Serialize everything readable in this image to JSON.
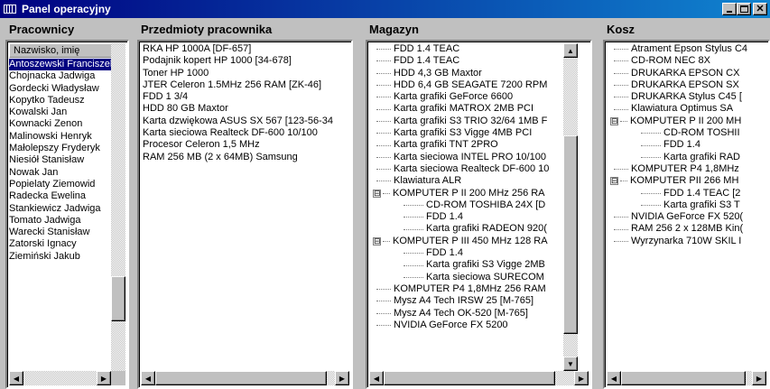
{
  "window": {
    "title": "Panel operacyjny",
    "icon": "panel-icon"
  },
  "pracownicy": {
    "header": "Pracownicy",
    "column": "Nazwisko, imię",
    "selected_index": 0,
    "items": [
      "Antoszewski Franciszek",
      "Chojnacka Jadwiga",
      "Gordecki Władysław",
      "Kopytko Tadeusz",
      "Kowalski Jan",
      "Kownacki Zenon",
      "Malinowski Henryk",
      "Małolepszy Fryderyk",
      "Niesiół Stanisław",
      "Nowak Jan",
      "Popielaty Ziemowid",
      "Radecka Ewelina",
      "Stankiewicz Jadwiga",
      "Tomato Jadwiga",
      "Warecki Stanisław",
      "Zatorski Ignacy",
      "Ziemiński Jakub"
    ]
  },
  "przedmioty": {
    "header": "Przedmioty pracownika",
    "items": [
      "RKA HP 1000A [DF-657]",
      "Podajnik kopert HP 1000 [34-678]",
      "Toner HP 1000",
      "JTER Celeron 1.5MHz 256 RAM [ZK-46]",
      "FDD 1 3/4",
      "HDD 80 GB Maxtor",
      "Karta dzwiękowa  ASUS SX 567 [123-56-34",
      "Karta sieciowa Realteck DF-600 10/100",
      "Procesor Celeron 1,5 MHz",
      "RAM 256 MB (2 x 64MB) Samsung"
    ]
  },
  "magazyn": {
    "header": "Magazyn",
    "items": [
      {
        "label": "FDD 1.4 TEAC",
        "level": 0
      },
      {
        "label": "FDD 1.4 TEAC",
        "level": 0
      },
      {
        "label": "HDD 4,3 GB Maxtor",
        "level": 0
      },
      {
        "label": "HDD 6,4 GB SEAGATE 7200 RPM",
        "level": 0
      },
      {
        "label": "Karta grafiki GeForce 6600",
        "level": 0
      },
      {
        "label": "Karta grafiki MATROX 2MB PCI",
        "level": 0
      },
      {
        "label": "Karta grafiki S3 TRIO 32/64 1MB F",
        "level": 0
      },
      {
        "label": "Karta grafiki S3 Vigge 4MB PCI",
        "level": 0
      },
      {
        "label": "Karta grafiki TNT 2PRO",
        "level": 0
      },
      {
        "label": "Karta sieciowa INTEL PRO 10/100",
        "level": 0
      },
      {
        "label": "Karta sieciowa Realteck DF-600 10",
        "level": 0
      },
      {
        "label": "Klawiatura ALR",
        "level": 0
      },
      {
        "label": "KOMPUTER P II 200 MHz 256 RA",
        "level": 0,
        "expander": "⊟"
      },
      {
        "label": "CD-ROM TOSHIBA 24X [D",
        "level": 1
      },
      {
        "label": "FDD 1.4",
        "level": 1
      },
      {
        "label": "Karta grafiki RADEON 920(",
        "level": 1
      },
      {
        "label": "KOMPUTER P III 450 MHz 128 RA",
        "level": 0,
        "expander": "⊟"
      },
      {
        "label": "FDD 1.4",
        "level": 1
      },
      {
        "label": "Karta grafiki S3 Vigge 2MB",
        "level": 1
      },
      {
        "label": "Karta sieciowa  SURECOM",
        "level": 1
      },
      {
        "label": "KOMPUTER P4 1,8MHz 256 RAM",
        "level": 0
      },
      {
        "label": "Mysz A4 Tech IRSW 25 [M-765]",
        "level": 0
      },
      {
        "label": "Mysz A4 Tech OK-520 [M-765]",
        "level": 0
      },
      {
        "label": "NVIDIA GeForce FX 5200",
        "level": 0
      }
    ]
  },
  "kosz": {
    "header": "Kosz",
    "items": [
      {
        "label": "Atrament Epson Stylus C4",
        "level": 0
      },
      {
        "label": "CD-ROM NEC 8X",
        "level": 0
      },
      {
        "label": "DRUKARKA EPSON CX",
        "level": 0
      },
      {
        "label": "DRUKARKA EPSON SX",
        "level": 0
      },
      {
        "label": "DRUKARKA Stylus C45 [",
        "level": 0
      },
      {
        "label": "Klawiatura Optimus SA",
        "level": 0
      },
      {
        "label": "KOMPUTER P II 200 MH",
        "level": 0,
        "expander": "⊟"
      },
      {
        "label": "CD-ROM TOSHII",
        "level": 1
      },
      {
        "label": "FDD 1.4",
        "level": 1
      },
      {
        "label": "Karta grafiki RAD",
        "level": 1
      },
      {
        "label": "KOMPUTER P4 1,8MHz",
        "level": 0
      },
      {
        "label": "KOMPUTER PII  266 MH",
        "level": 0,
        "expander": "⊟"
      },
      {
        "label": "FDD 1.4 TEAC [2",
        "level": 1
      },
      {
        "label": "Karta grafiki S3 T",
        "level": 1
      },
      {
        "label": "NVIDIA GeForce FX 520(",
        "level": 0
      },
      {
        "label": "RAM 256 2 x 128MB Kin(",
        "level": 0
      },
      {
        "label": "Wyrzynarka 710W SKIL I",
        "level": 0
      }
    ]
  }
}
